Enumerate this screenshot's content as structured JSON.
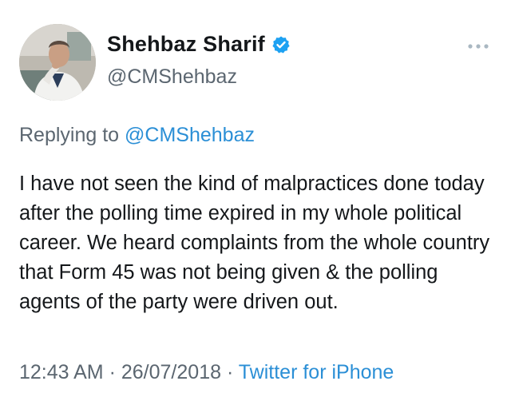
{
  "user": {
    "display_name": "Shehbaz Sharif",
    "handle": "@CMShehbaz",
    "verified": true
  },
  "reply": {
    "prefix": "Replying to",
    "mention": "@CMShehbaz"
  },
  "tweet": {
    "text": "I have not seen the kind of malpractices done today after the polling time expired in my whole political career. We heard complaints from the whole country that Form 45 was not being given & the polling agents of the party were driven out."
  },
  "meta": {
    "time": "12:43 AM",
    "date": "26/07/2018",
    "separator": "·",
    "source": "Twitter for iPhone"
  },
  "icons": {
    "verified": "verified-badge-icon",
    "more": "more-options-icon"
  },
  "colors": {
    "link": "#2b8fd6",
    "secondary_text": "#5b6670",
    "primary_text": "#14171a",
    "verified": "#1da1f2"
  }
}
